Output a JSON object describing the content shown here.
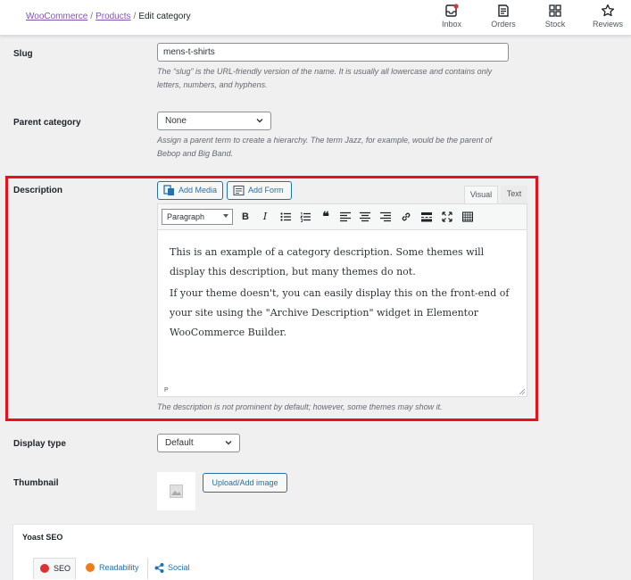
{
  "header": {
    "breadcrumb": {
      "root": "WooCommerce",
      "section": "Products",
      "current": "Edit category",
      "separator": "/"
    },
    "nav": [
      {
        "label": "Inbox",
        "icon": "inbox-icon"
      },
      {
        "label": "Orders",
        "icon": "orders-icon"
      },
      {
        "label": "Stock",
        "icon": "stock-icon"
      },
      {
        "label": "Reviews",
        "icon": "star-icon"
      }
    ]
  },
  "form": {
    "slug": {
      "label": "Slug",
      "value": "mens-t-shirts",
      "help": "The “slug” is the URL-friendly version of the name. It is usually all lowercase and contains only letters, numbers, and hyphens."
    },
    "parent": {
      "label": "Parent category",
      "value": "None",
      "help": "Assign a parent term to create a hierarchy. The term Jazz, for example, would be the parent of Bebop and Big Band."
    },
    "description": {
      "label": "Description",
      "add_media": "Add Media",
      "add_form": "Add Form",
      "tab_visual": "Visual",
      "tab_text": "Text",
      "format": "Paragraph",
      "paragraphs": [
        "This is an example of a category description. Some themes will display this description, but many themes do not.",
        "If your theme doesn't, you can easily display this on the front-end of your site using the \"Archive Description\" widget in Elementor WooCommerce Builder."
      ],
      "path": "P",
      "help": "The description is not prominent by default; however, some themes may show it.",
      "highlight_color": "#e8101a"
    },
    "display_type": {
      "label": "Display type",
      "value": "Default"
    },
    "thumbnail": {
      "label": "Thumbnail",
      "button": "Upload/Add image"
    }
  },
  "yoast": {
    "title": "Yoast SEO",
    "tabs": [
      {
        "label": "SEO",
        "status_color": "#dc3232"
      },
      {
        "label": "Readability",
        "status_color": "#ee7c1b"
      },
      {
        "label": "Social",
        "icon": "share-icon"
      }
    ]
  },
  "colors": {
    "accent": "#2271b1",
    "woo_purple": "#7f54b3"
  }
}
